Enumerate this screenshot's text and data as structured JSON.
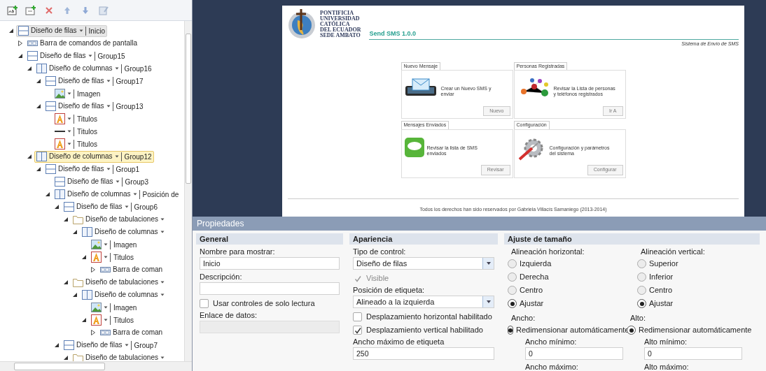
{
  "toolbar": {
    "buttons": [
      {
        "kind": "add-text"
      },
      {
        "kind": "add-item"
      },
      {
        "kind": "delete"
      },
      {
        "kind": "up"
      },
      {
        "kind": "down"
      },
      {
        "kind": "edit"
      }
    ]
  },
  "tree": [
    {
      "kind": "rows",
      "label": "Diseño de filas",
      "name": "Inicio",
      "expanded": true,
      "selected": true,
      "hovered": false,
      "children": [
        {
          "kind": "commandbar",
          "label": "Barra de comandos de pantalla",
          "expanded": false,
          "selected": false,
          "hovered": false
        },
        {
          "kind": "rows",
          "label": "Diseño de filas",
          "name": "Group15",
          "expanded": true,
          "selected": false,
          "hovered": false,
          "children": [
            {
              "kind": "columns",
              "label": "Diseño de columnas",
              "name": "Group16",
              "expanded": true,
              "selected": false,
              "hovered": false,
              "children": [
                {
                  "kind": "rows",
                  "label": "Diseño de filas",
                  "name": "Group17",
                  "expanded": true,
                  "selected": false,
                  "hovered": false,
                  "children": [
                    {
                      "kind": "image",
                      "name": "Imagen",
                      "selected": false,
                      "hovered": false
                    }
                  ]
                },
                {
                  "kind": "rows",
                  "label": "Diseño de filas",
                  "name": "Group13",
                  "expanded": true,
                  "selected": false,
                  "hovered": false,
                  "children": [
                    {
                      "kind": "title",
                      "name": "Titulos",
                      "selected": false,
                      "hovered": false
                    },
                    {
                      "kind": "line",
                      "name": "Titulos",
                      "selected": false,
                      "hovered": false
                    },
                    {
                      "kind": "title",
                      "name": "Titulos",
                      "selected": false,
                      "hovered": false
                    }
                  ]
                }
              ]
            },
            {
              "kind": "columns",
              "label": "Diseño de columnas",
              "name": "Group12",
              "expanded": true,
              "selected": false,
              "hovered": true,
              "children": [
                {
                  "kind": "rows",
                  "label": "Diseño de filas",
                  "name": "Group1",
                  "expanded": true,
                  "selected": false,
                  "hovered": false,
                  "children": [
                    {
                      "kind": "rows",
                      "label": "Diseño de filas",
                      "name": "Group3",
                      "selected": false,
                      "hovered": false
                    },
                    {
                      "kind": "columns",
                      "label": "Diseño de columnas",
                      "name": "Posición de",
                      "expanded": true,
                      "selected": false,
                      "hovered": false,
                      "children": [
                        {
                          "kind": "rows",
                          "label": "Diseño de filas",
                          "name": "Group6",
                          "expanded": true,
                          "selected": false,
                          "hovered": false,
                          "children": [
                            {
                              "kind": "tabs",
                              "label": "Diseño de tabulaciones",
                              "expanded": true,
                              "selected": false,
                              "hovered": false,
                              "children": [
                                {
                                  "kind": "columns",
                                  "label": "Diseño de columnas",
                                  "expanded": true,
                                  "selected": false,
                                  "hovered": false,
                                  "children": [
                                    {
                                      "kind": "image",
                                      "name": "Imagen",
                                      "selected": false,
                                      "hovered": false
                                    },
                                    {
                                      "kind": "title",
                                      "name": "Titulos",
                                      "expanded": true,
                                      "selected": false,
                                      "hovered": false,
                                      "children": [
                                        {
                                          "kind": "commandbar",
                                          "label": "Barra de coman",
                                          "expanded": false,
                                          "selected": false,
                                          "hovered": false
                                        }
                                      ]
                                    }
                                  ]
                                }
                              ]
                            },
                            {
                              "kind": "tabs",
                              "label": "Diseño de tabulaciones",
                              "expanded": true,
                              "selected": false,
                              "hovered": false,
                              "children": [
                                {
                                  "kind": "columns",
                                  "label": "Diseño de columnas",
                                  "expanded": true,
                                  "selected": false,
                                  "hovered": false,
                                  "children": [
                                    {
                                      "kind": "image",
                                      "name": "Imagen",
                                      "selected": false,
                                      "hovered": false
                                    },
                                    {
                                      "kind": "title",
                                      "name": "Titulos",
                                      "expanded": true,
                                      "selected": false,
                                      "hovered": false,
                                      "children": [
                                        {
                                          "kind": "commandbar",
                                          "label": "Barra de coman",
                                          "expanded": false,
                                          "selected": false,
                                          "hovered": false
                                        }
                                      ]
                                    }
                                  ]
                                }
                              ]
                            }
                          ]
                        },
                        {
                          "kind": "rows",
                          "label": "Diseño de filas",
                          "name": "Group7",
                          "expanded": true,
                          "selected": false,
                          "hovered": false,
                          "children": [
                            {
                              "kind": "tabs",
                              "label": "Diseño de tabulaciones",
                              "expanded": true,
                              "selected": false,
                              "hovered": false
                            }
                          ]
                        }
                      ]
                    }
                  ]
                }
              ]
            }
          ]
        }
      ]
    }
  ],
  "preview": {
    "logo_lines": [
      "PONTIFICIA",
      "UNIVERSIDAD",
      "CATÓLICA",
      "DEL ECUADOR",
      "SEDE AMBATO"
    ],
    "app_title": "Send SMS 1.0.0",
    "subtitle": "Sistema de Envío de SMS",
    "cards": [
      {
        "kind": "envelope",
        "tab": "Nuevo Mensaje",
        "description": "Crear un Nuevo SMS y enviar",
        "button": "Nuevo"
      },
      {
        "kind": "people",
        "tab": "Personas Registradas",
        "description": "Revisar la Lista de personas y teléfonos registrados",
        "button": "Ir A"
      },
      {
        "kind": "sms",
        "tab": "Mensajes Enviados",
        "description": "Revisar la lista de SMS enviados",
        "button": "Revisar"
      },
      {
        "kind": "gear",
        "tab": "Configuración",
        "description": "Configuración y parámetros del sistema",
        "button": "Configurar"
      }
    ],
    "footer": "Todos los derechos han sido reservados por Gabriela Villacís Samaniego (2013-2014)"
  },
  "properties": {
    "title": "Propiedades",
    "general": {
      "heading": "General",
      "display_name": {
        "label": "Nombre para mostrar:",
        "value": "Inicio"
      },
      "description": {
        "label": "Descripción:"
      },
      "read_only": {
        "label": "Usar controles de solo lectura",
        "checked": false
      },
      "data_binding": {
        "label": "Enlace de datos:",
        "disabled": true
      }
    },
    "appearance": {
      "heading": "Apariencia",
      "control_type": {
        "label": "Tipo de control:",
        "value": "Diseño de filas"
      },
      "visible": {
        "label": "Visible",
        "checked": true,
        "disabled": true
      },
      "label_position": {
        "label": "Posición de etiqueta:",
        "value": "Alineado a la izquierda"
      },
      "horizontal_scroll": {
        "label": "Desplazamiento horizontal habilitado",
        "checked": false
      },
      "vertical_scroll": {
        "label": "Desplazamiento vertical habilitado",
        "checked": true
      },
      "max_label_width": {
        "label": "Ancho máximo de etiqueta",
        "value": "250"
      }
    },
    "sizing": {
      "heading": "Ajuste de tamaño",
      "horizontal_alignment": {
        "label": "Alineación horizontal:",
        "options": [
          {
            "label": "Izquierda",
            "selected": false
          },
          {
            "label": "Derecha",
            "selected": false
          },
          {
            "label": "Centro",
            "selected": false
          },
          {
            "label": "Ajustar",
            "selected": true
          }
        ]
      },
      "vertical_alignment": {
        "label": "Alineación vertical:",
        "options": [
          {
            "label": "Superior",
            "selected": false
          },
          {
            "label": "Inferior",
            "selected": false
          },
          {
            "label": "Centro",
            "selected": false
          },
          {
            "label": "Ajustar",
            "selected": true
          }
        ]
      },
      "width": {
        "label": "Ancho:",
        "option": {
          "label": "Redimensionar automáticamente",
          "selected": true
        },
        "min": {
          "label": "Ancho mínimo:",
          "value": "0"
        },
        "max": {
          "label": "Ancho máximo:"
        }
      },
      "height": {
        "label": "Alto:",
        "option": {
          "label": "Redimensionar automáticamente",
          "selected": true
        },
        "min": {
          "label": "Alto mínimo:",
          "value": "0"
        },
        "max": {
          "label": "Alto máximo:"
        }
      }
    }
  }
}
